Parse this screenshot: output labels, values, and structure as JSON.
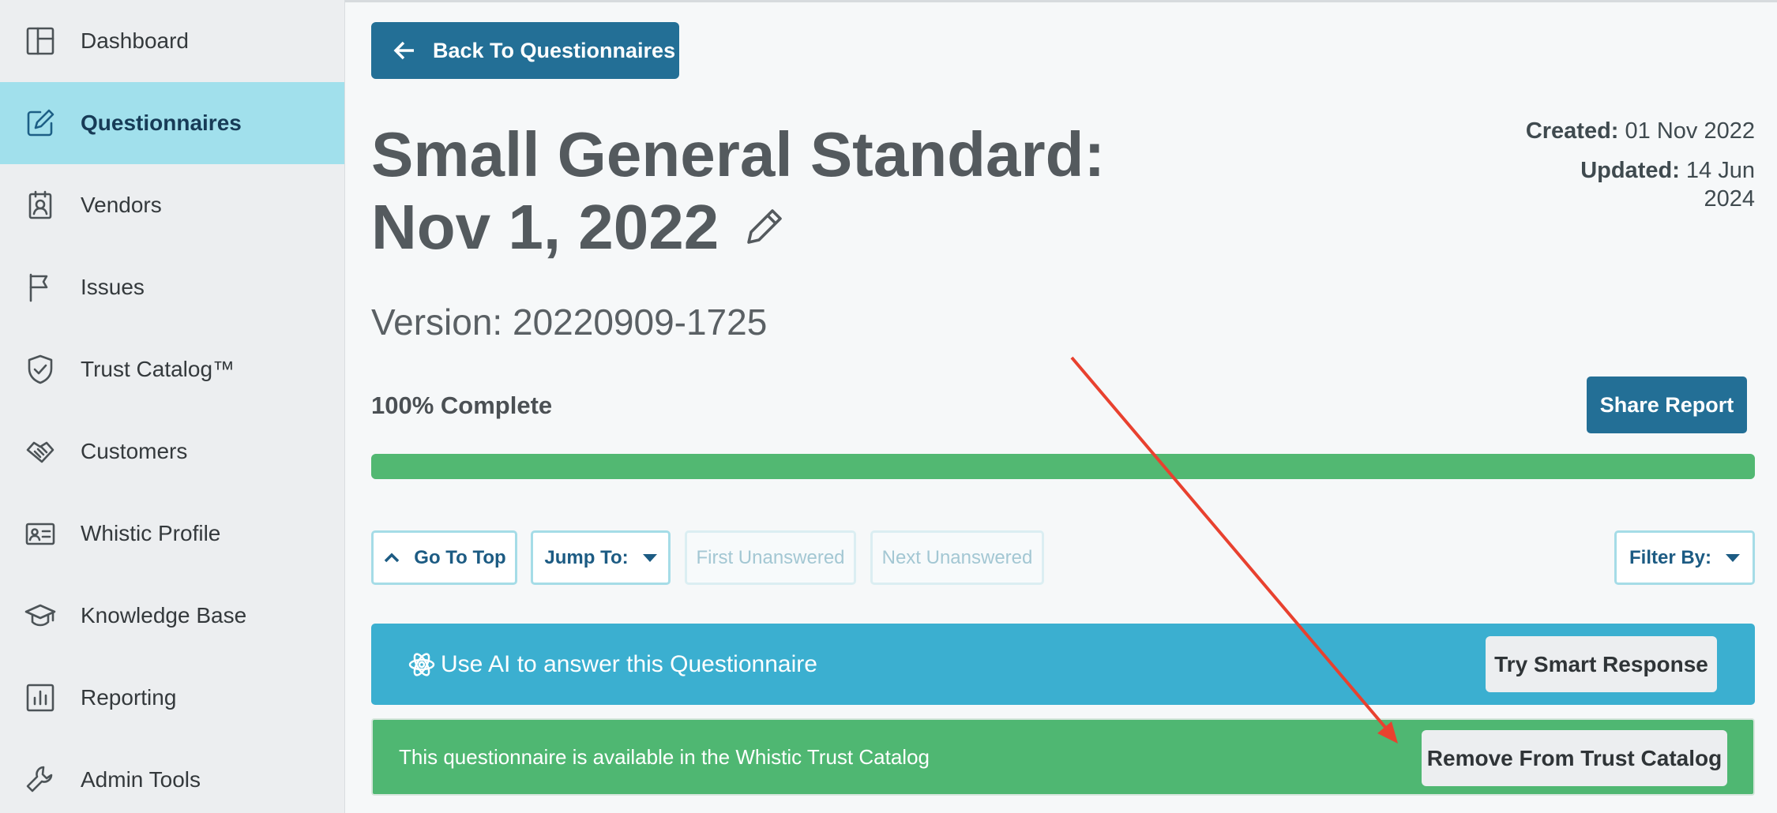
{
  "sidebar": {
    "items": [
      {
        "label": "Dashboard",
        "icon": "dashboard-icon"
      },
      {
        "label": "Questionnaires",
        "icon": "edit-icon",
        "active": true
      },
      {
        "label": "Vendors",
        "icon": "vendor-badge-icon"
      },
      {
        "label": "Issues",
        "icon": "flag-icon"
      },
      {
        "label": "Trust Catalog™",
        "icon": "shield-check-icon"
      },
      {
        "label": "Customers",
        "icon": "handshake-icon"
      },
      {
        "label": "Whistic Profile",
        "icon": "id-card-icon"
      },
      {
        "label": "Knowledge Base",
        "icon": "graduation-cap-icon"
      },
      {
        "label": "Reporting",
        "icon": "bar-chart-icon"
      },
      {
        "label": "Admin Tools",
        "icon": "wrench-icon"
      }
    ]
  },
  "header": {
    "back_label": "Back To Questionnaires",
    "title_line1": "Small General Standard:",
    "title_line2": "Nov 1, 2022",
    "created_label": "Created:",
    "created_value": "01 Nov 2022",
    "updated_label": "Updated:",
    "updated_value": "14 Jun 2024",
    "version": "Version: 20220909-1725"
  },
  "progress": {
    "label": "100% Complete",
    "fraction": 1.0,
    "share_label": "Share Report"
  },
  "toolbar": {
    "go_top": "Go To Top",
    "jump_to": "Jump To:",
    "first_unanswered": "First Unanswered",
    "next_unanswered": "Next Unanswered",
    "filter_by": "Filter By:"
  },
  "ai_banner": {
    "text": "Use AI to answer this Questionnaire",
    "button": "Try Smart Response"
  },
  "trust_banner": {
    "text": "This questionnaire is available in the Whistic Trust Catalog",
    "button": "Remove From Trust Catalog"
  },
  "colors": {
    "primary": "#236f96",
    "active_nav": "#a1e0ec",
    "progress": "#52b872",
    "ai_banner": "#3bafd0",
    "trust_banner": "#4fb772",
    "annotation_arrow": "#e8412f"
  }
}
